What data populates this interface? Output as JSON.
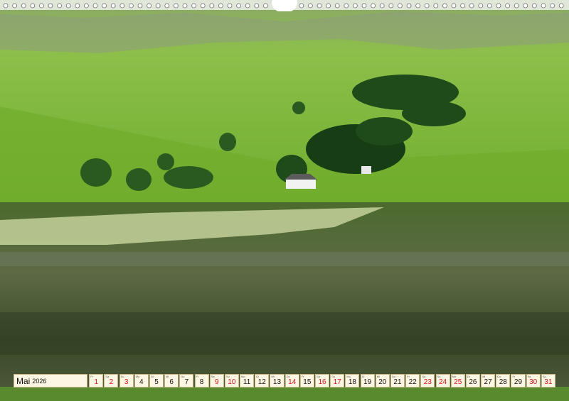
{
  "calendar": {
    "month": "Mai",
    "year": "2026",
    "days": [
      {
        "wd": "Fr",
        "d": "1",
        "red": true
      },
      {
        "wd": "Sa",
        "d": "2",
        "red": true
      },
      {
        "wd": "So",
        "d": "3",
        "red": true
      },
      {
        "wd": "Mo",
        "d": "4",
        "red": false
      },
      {
        "wd": "Di",
        "d": "5",
        "red": false
      },
      {
        "wd": "Mi",
        "d": "6",
        "red": false
      },
      {
        "wd": "Do",
        "d": "7",
        "red": false
      },
      {
        "wd": "Fr",
        "d": "8",
        "red": false
      },
      {
        "wd": "Sa",
        "d": "9",
        "red": true
      },
      {
        "wd": "So",
        "d": "10",
        "red": true
      },
      {
        "wd": "Mo",
        "d": "11",
        "red": false
      },
      {
        "wd": "Di",
        "d": "12",
        "red": false
      },
      {
        "wd": "Mi",
        "d": "13",
        "red": false
      },
      {
        "wd": "Do",
        "d": "14",
        "red": true
      },
      {
        "wd": "Fr",
        "d": "15",
        "red": false
      },
      {
        "wd": "Sa",
        "d": "16",
        "red": true
      },
      {
        "wd": "So",
        "d": "17",
        "red": true
      },
      {
        "wd": "Mo",
        "d": "18",
        "red": false
      },
      {
        "wd": "Di",
        "d": "19",
        "red": false
      },
      {
        "wd": "Mi",
        "d": "20",
        "red": false
      },
      {
        "wd": "Do",
        "d": "21",
        "red": false
      },
      {
        "wd": "Fr",
        "d": "22",
        "red": false
      },
      {
        "wd": "Sa",
        "d": "23",
        "red": true
      },
      {
        "wd": "So",
        "d": "24",
        "red": true
      },
      {
        "wd": "Mo",
        "d": "25",
        "red": true
      },
      {
        "wd": "Di",
        "d": "26",
        "red": false
      },
      {
        "wd": "Mi",
        "d": "27",
        "red": false
      },
      {
        "wd": "Do",
        "d": "28",
        "red": false
      },
      {
        "wd": "Fr",
        "d": "29",
        "red": false
      },
      {
        "wd": "Sa",
        "d": "30",
        "red": true
      },
      {
        "wd": "So",
        "d": "31",
        "red": true
      }
    ]
  },
  "colors": {
    "holiday_red": "#d8111c",
    "cell_bg": "#fdf6e3"
  }
}
